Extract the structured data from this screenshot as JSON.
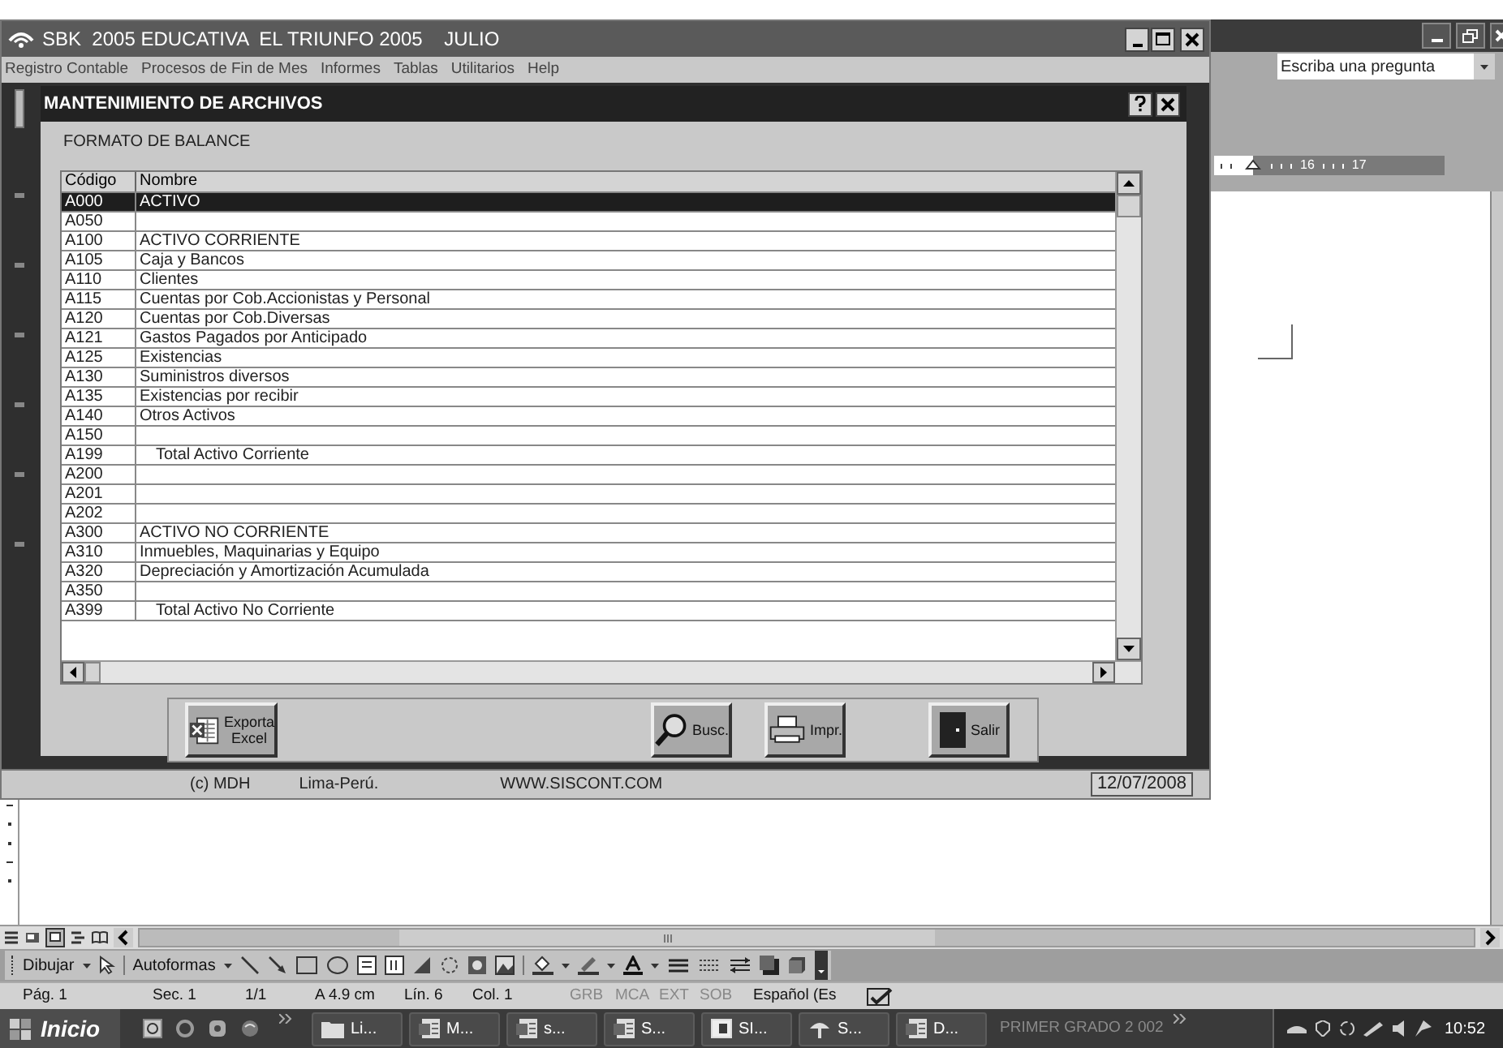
{
  "app_window": {
    "title": "SBK  2005 EDUCATIVA  EL TRIUNFO 2005    JULIO",
    "menu": [
      "Registro Contable",
      "Procesos de Fin de Mes",
      "Informes",
      "Tablas",
      "Utilitarios",
      "Help"
    ]
  },
  "dialog": {
    "title": "MANTENIMIENTO DE ARCHIVOS",
    "heading": "FORMATO DE BALANCE",
    "table": {
      "columns": [
        "Código",
        "Nombre"
      ],
      "rows": [
        {
          "code": "A000",
          "name": "ACTIVO",
          "indented": false,
          "selected": true
        },
        {
          "code": "A050",
          "indented": false,
          "selected": false
        },
        {
          "code": "A100",
          "name": "ACTIVO CORRIENTE",
          "indented": false,
          "selected": false
        },
        {
          "code": "A105",
          "name": "Caja y Bancos",
          "indented": false,
          "selected": false
        },
        {
          "code": "A110",
          "name": "Clientes",
          "indented": false,
          "selected": false
        },
        {
          "code": "A115",
          "name": "Cuentas por Cob.Accionistas y Personal",
          "indented": false,
          "selected": false
        },
        {
          "code": "A120",
          "name": "Cuentas por Cob.Diversas",
          "indented": false,
          "selected": false
        },
        {
          "code": "A121",
          "name": "Gastos Pagados por Anticipado",
          "indented": false,
          "selected": false
        },
        {
          "code": "A125",
          "name": "Existencias",
          "indented": false,
          "selected": false
        },
        {
          "code": "A130",
          "name": "Suministros diversos",
          "indented": false,
          "selected": false
        },
        {
          "code": "A135",
          "name": "Existencias por recibir",
          "indented": false,
          "selected": false
        },
        {
          "code": "A140",
          "name": "Otros Activos",
          "indented": false,
          "selected": false
        },
        {
          "code": "A150",
          "indented": false,
          "selected": false
        },
        {
          "code": "A199",
          "name": "Total Activo Corriente",
          "indented": true,
          "selected": false
        },
        {
          "code": "A200",
          "indented": false,
          "selected": false
        },
        {
          "code": "A201",
          "indented": false,
          "selected": false
        },
        {
          "code": "A202",
          "indented": false,
          "selected": false
        },
        {
          "code": "A300",
          "name": "ACTIVO NO CORRIENTE",
          "indented": false,
          "selected": false
        },
        {
          "code": "A310",
          "name": "Inmuebles, Maquinarias y Equipo",
          "indented": false,
          "selected": false
        },
        {
          "code": "A320",
          "name": "Depreciación y Amortización Acumulada",
          "indented": false,
          "selected": false
        },
        {
          "code": "A350",
          "indented": false,
          "selected": false
        },
        {
          "code": "A399",
          "name": "Total Activo No Corriente",
          "indented": true,
          "selected": false
        }
      ]
    },
    "buttons": [
      {
        "kind": "excel",
        "label": "Exporta\nExcel"
      },
      {
        "kind": "search",
        "label": "Busc."
      },
      {
        "kind": "print",
        "label": "Impr."
      },
      {
        "kind": "exit",
        "label": "Salir"
      }
    ]
  },
  "app_status_bar": [
    "(c) MDH",
    "Lima-Perú.",
    "WWW.SISCONT.COM",
    "12/07/2008"
  ],
  "word": {
    "question_box": {
      "placeholder": "Escriba una pregunta"
    },
    "ruler_labels": [
      "16",
      "17"
    ],
    "drawing_toolbar": [
      "Dibujar",
      "Autoformas"
    ],
    "status_bar": [
      {
        "text": "Pág. 1",
        "disabled": false
      },
      {
        "text": "Sec. 1",
        "disabled": false
      },
      {
        "text": "1/1",
        "disabled": false
      },
      {
        "text": "A 4.9 cm",
        "disabled": false
      },
      {
        "text": "Lín. 6",
        "disabled": false
      },
      {
        "text": "Col. 1",
        "disabled": false
      },
      {
        "text": "GRB",
        "disabled": true
      },
      {
        "text": "MCA",
        "disabled": true
      },
      {
        "text": "EXT",
        "disabled": true
      },
      {
        "text": "SOB",
        "disabled": true
      },
      {
        "text": "Español (Es",
        "disabled": false
      }
    ]
  },
  "taskbar": {
    "start": "Inicio",
    "tasks": [
      {
        "kind": "folder",
        "label": "Li..."
      },
      {
        "kind": "doc",
        "label": "M..."
      },
      {
        "kind": "doc",
        "label": "s..."
      },
      {
        "kind": "doc",
        "label": "S..."
      },
      {
        "kind": "app",
        "label": "SI..."
      },
      {
        "kind": "sbk",
        "label": "S..."
      },
      {
        "kind": "doc",
        "label": "D..."
      }
    ],
    "toolbar_label": "PRIMER GRADO 2 002",
    "clock": "10:52"
  }
}
